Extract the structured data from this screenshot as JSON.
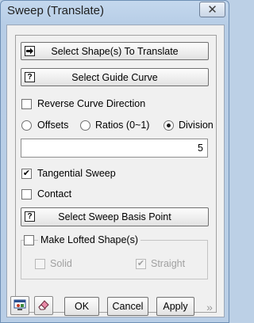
{
  "window": {
    "title": "Sweep (Translate)",
    "close_glyph": "✕"
  },
  "buttons": {
    "select_shapes": {
      "label": "Select Shape(s) To Translate",
      "icon": "arrow-select-icon"
    },
    "select_guide": {
      "label": "Select Guide Curve",
      "icon": "question-icon"
    },
    "select_basis": {
      "label": "Select Sweep Basis Point",
      "icon": "question-icon"
    }
  },
  "options": {
    "reverse_direction": {
      "label": "Reverse Curve Direction",
      "checked": false
    },
    "mode": {
      "items": [
        {
          "label": "Offsets",
          "selected": false
        },
        {
          "label": "Ratios (0~1)",
          "selected": false
        },
        {
          "label": "Division",
          "selected": true
        }
      ]
    },
    "value": "5",
    "tangential_sweep": {
      "label": "Tangential Sweep",
      "checked": true
    },
    "contact": {
      "label": "Contact",
      "checked": false
    }
  },
  "lofted": {
    "label": "Make Lofted Shape(s)",
    "checked": false,
    "solid": {
      "label": "Solid",
      "checked": false,
      "enabled": false
    },
    "straight": {
      "label": "Straight",
      "checked": true,
      "enabled": false
    }
  },
  "footer": {
    "ok": "OK",
    "cancel": "Cancel",
    "apply": "Apply",
    "more": "»",
    "icon1": "preview-icon",
    "icon2": "eraser-icon"
  },
  "glyphs": {
    "check": "✔",
    "question": "?"
  }
}
